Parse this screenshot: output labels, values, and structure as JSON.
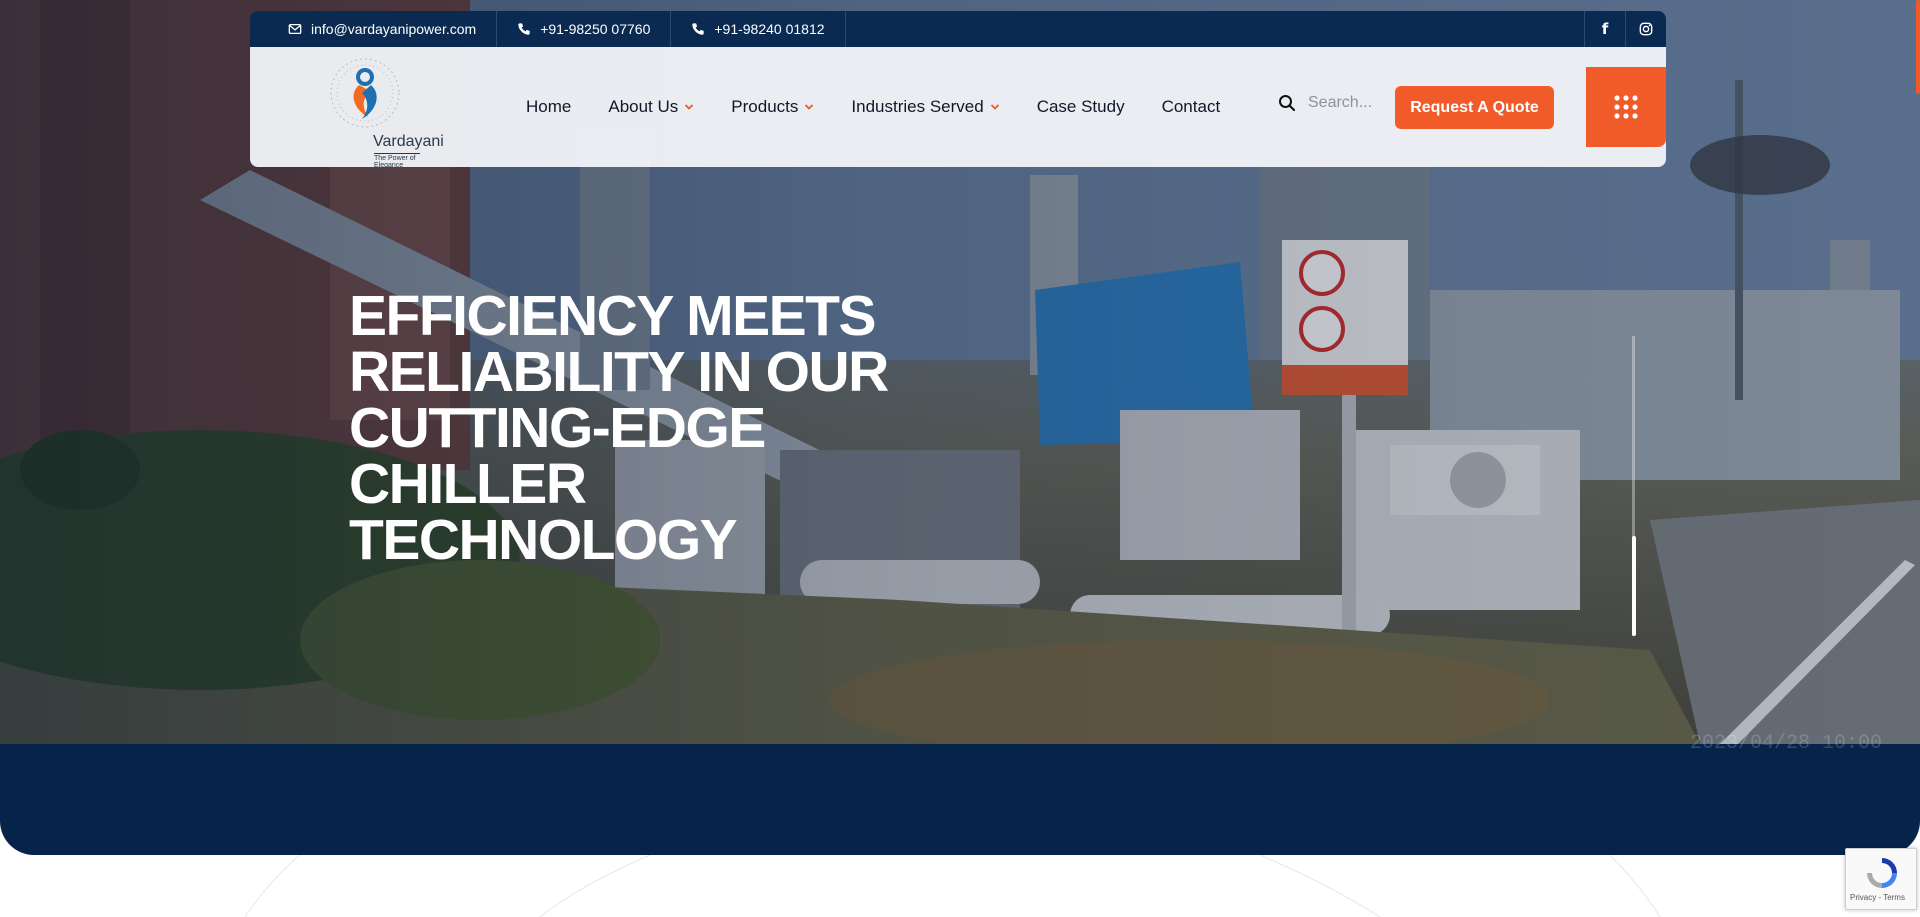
{
  "topbar": {
    "email": "info@vardayanipower.com",
    "phone_1": "+91-98250 07760",
    "phone_2": "+91-98240 01812",
    "social": [
      "facebook-icon",
      "instagram-icon"
    ]
  },
  "brand": {
    "name": "Vardayani",
    "tagline": "The Power of Elegance"
  },
  "nav": {
    "items": [
      {
        "label": "Home",
        "dropdown": false
      },
      {
        "label": "About Us",
        "dropdown": true
      },
      {
        "label": "Products",
        "dropdown": true
      },
      {
        "label": "Industries Served",
        "dropdown": true
      },
      {
        "label": "Case Study",
        "dropdown": false
      },
      {
        "label": "Contact",
        "dropdown": false
      }
    ],
    "search_placeholder": "Search...",
    "quote_label": "Request A Quote"
  },
  "hero": {
    "title": "EFFICIENCY MEETS\nRELIABILITY IN OUR\nCUTTING-EDGE\nCHILLER\nTECHNOLOGY",
    "photo_stamp": "2023/04/28 10:00"
  },
  "recaptcha": {
    "text": "Privacy - Terms"
  },
  "colors": {
    "navy": "#0b2a52",
    "hero_bottom": "#06234a",
    "accent": "#f15a29"
  }
}
